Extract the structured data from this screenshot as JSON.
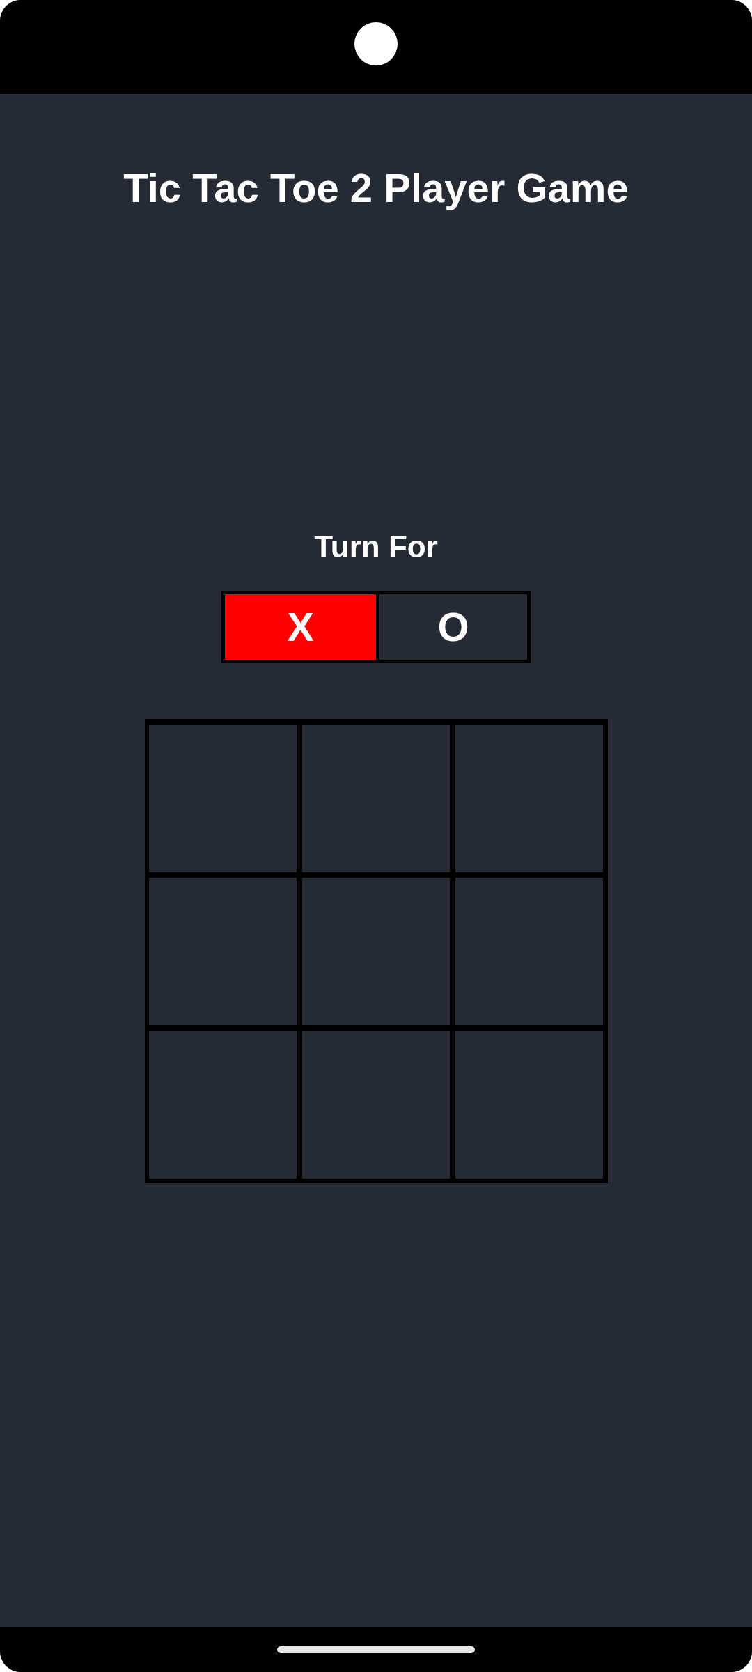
{
  "title": "Tic Tac Toe 2 Player Game",
  "turn_label": "Turn For",
  "players": [
    {
      "label": "X",
      "selected": true
    },
    {
      "label": "O",
      "selected": false
    }
  ]
}
